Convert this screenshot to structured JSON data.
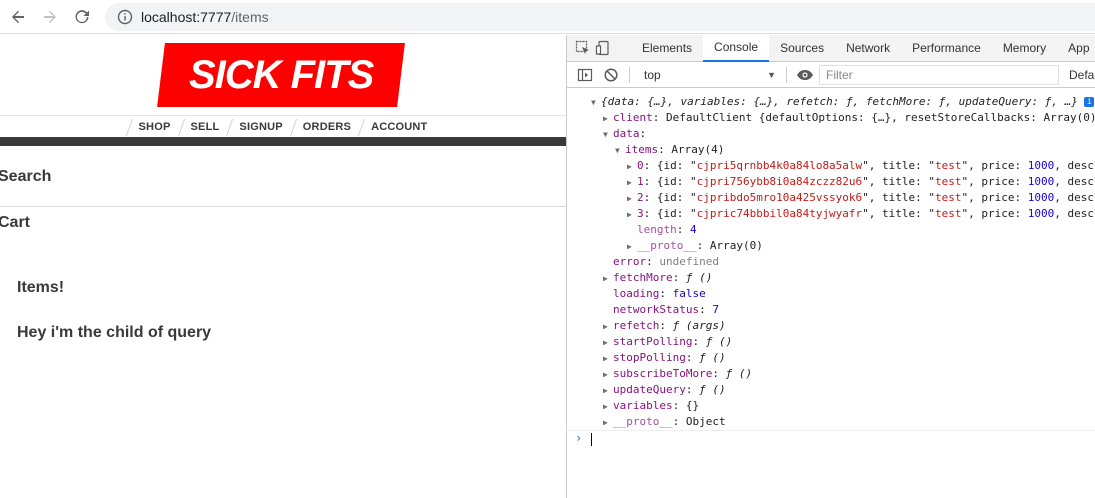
{
  "browser": {
    "url_host": "localhost:7777",
    "url_path": "/items"
  },
  "page": {
    "logo_text": "SICK FITS",
    "nav": [
      "SHOP",
      "SELL",
      "SIGNUP",
      "ORDERS",
      "ACCOUNT"
    ],
    "search_label": "Search",
    "cart_label": "Cart",
    "items_heading": "Items!",
    "child_text": "Hey i'm the child of query"
  },
  "devtools": {
    "tabs": [
      "Elements",
      "Console",
      "Sources",
      "Network",
      "Performance",
      "Memory",
      "App"
    ],
    "active_tab": "Console",
    "context": "top",
    "filter_placeholder": "Filter",
    "levels_label": "Defau",
    "console": {
      "root": "{data: {…}, variables: {…}, refetch: ƒ, fetchMore: ƒ, updateQuery: ƒ, …}",
      "client_key": "client",
      "client_value": "DefaultClient {defaultOptions: {…}, resetStoreCallbacks: Array(0)",
      "data_key": "data",
      "items_key": "items",
      "items_value": "Array(4)",
      "items": [
        {
          "index": "0",
          "id": "cjpri5qrnbb4k0a84lo8a5alw",
          "rest_num": "1000",
          "rest_tail": ", descr"
        },
        {
          "index": "1",
          "id": "cjpri756ybb8i0a84zczz82u6",
          "rest_num": "1000",
          "rest_tail": ", descr"
        },
        {
          "index": "2",
          "id": "cjpribdo5mro10a425vssyok6",
          "rest_num": "1000",
          "rest_tail": ", descr"
        },
        {
          "index": "3",
          "id": "cjpric74bbbil0a84tyjwyafr",
          "rest_num": "1000",
          "rest_tail": ", descr"
        }
      ],
      "item_title": "test",
      "length_key": "length",
      "length_value": "4",
      "proto_key": "__proto__",
      "proto_array": "Array(0)",
      "error_key": "error",
      "error_value": "undefined",
      "fetchMore_key": "fetchMore",
      "fn_empty": "ƒ ()",
      "loading_key": "loading",
      "loading_value": "false",
      "networkStatus_key": "networkStatus",
      "networkStatus_value": "7",
      "refetch_key": "refetch",
      "fn_args": "ƒ (args)",
      "startPolling_key": "startPolling",
      "stopPolling_key": "stopPolling",
      "subscribeToMore_key": "subscribeToMore",
      "updateQuery_key": "updateQuery",
      "variables_key": "variables",
      "variables_value": "{}",
      "proto_object": "Object",
      "prompt": "›"
    }
  },
  "colors": {
    "logo_red": "#ff0000",
    "dark_bar": "#393939",
    "active_tab_underline": "#1a73e8"
  }
}
